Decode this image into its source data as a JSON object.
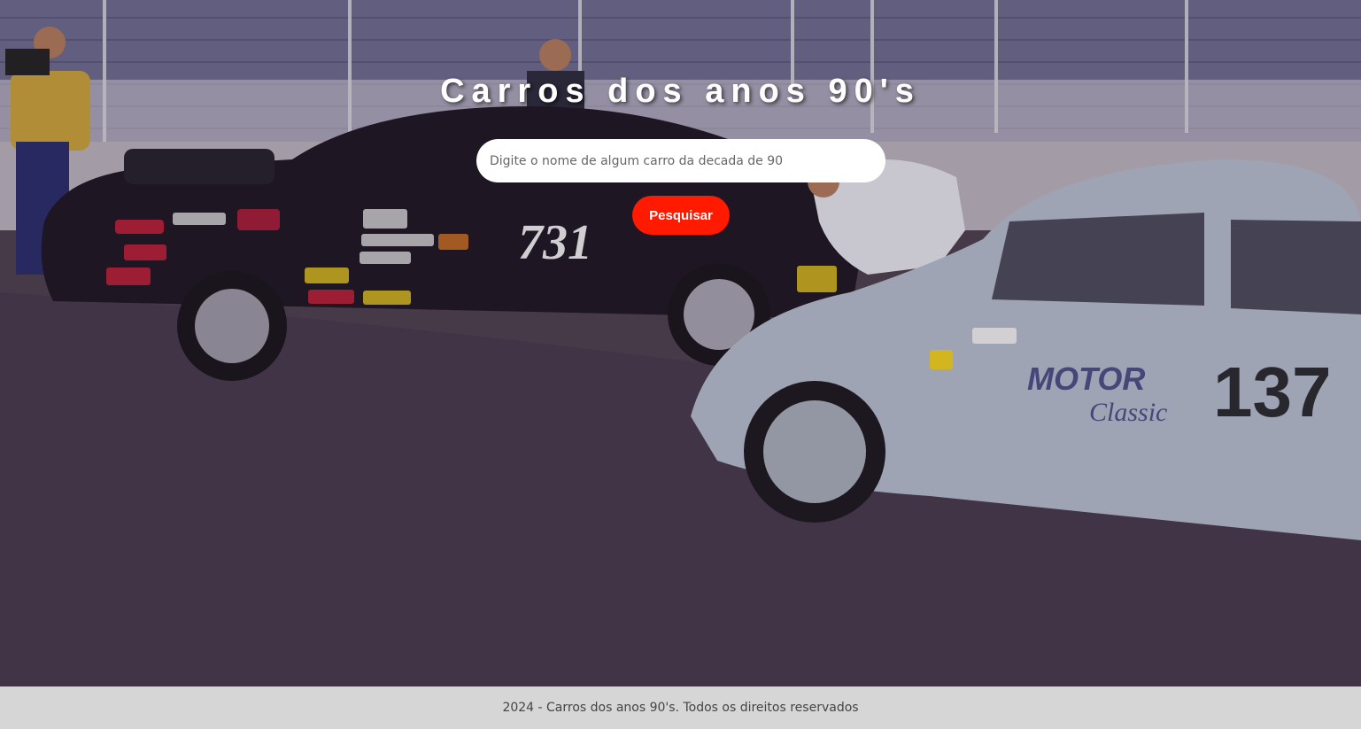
{
  "header": {
    "title": "Carros dos anos 90's"
  },
  "search": {
    "placeholder": "Digite o nome de algum carro da decada de 90",
    "value": "",
    "button_label": "Pesquisar"
  },
  "hero_car_numbers": {
    "left_car": "731",
    "right_car": "137",
    "right_car_livery_1": "MOTOR",
    "right_car_livery_2": "Classic"
  },
  "footer": {
    "text": "2024 - Carros dos anos 90's. Todos os direitos reservados"
  },
  "colors": {
    "button": "#ff1a00",
    "footer_bg": "#d6d6d6",
    "asphalt": "#4a3e4c",
    "stands": "#6b6a8c"
  }
}
